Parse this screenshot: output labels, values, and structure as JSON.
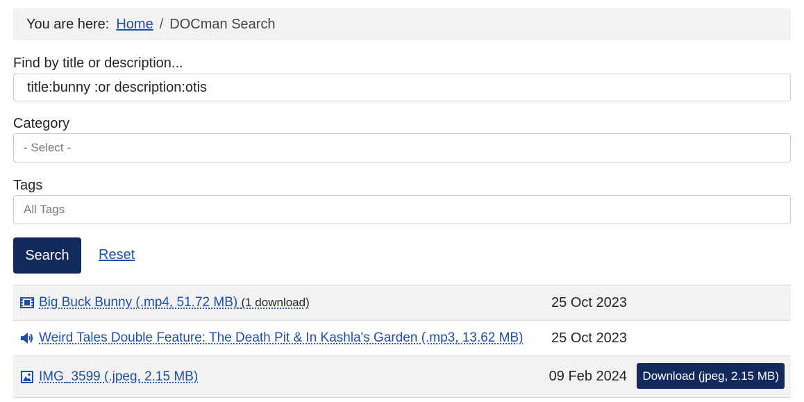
{
  "breadcrumb": {
    "lead": "You are here:",
    "home": "Home",
    "separator": "/",
    "current": "DOCman Search"
  },
  "search": {
    "label": "Find by title or description...",
    "value": "title:bunny :or description:otis"
  },
  "category": {
    "label": "Category",
    "placeholder": "- Select -"
  },
  "tags": {
    "label": "Tags",
    "placeholder": "All Tags"
  },
  "buttons": {
    "search": "Search",
    "reset": "Reset"
  },
  "results": [
    {
      "icon": "video-icon",
      "title": "Big Buck Bunny (.mp4, 51.72 MB)",
      "downloads": "(1 download)",
      "date": "25 Oct 2023"
    },
    {
      "icon": "audio-icon",
      "title": "Weird Tales Double Feature: The Death Pit & In Kashla's Garden (.mp3, 13.62 MB)",
      "date": "25 Oct 2023"
    },
    {
      "icon": "image-icon",
      "title": "IMG_3599 (.jpeg, 2.15 MB)",
      "date": "09 Feb 2024",
      "download_button": "Download (jpeg, 2.15 MB)"
    }
  ],
  "colors": {
    "accent": "#13285c",
    "link": "#1d4ea8"
  }
}
